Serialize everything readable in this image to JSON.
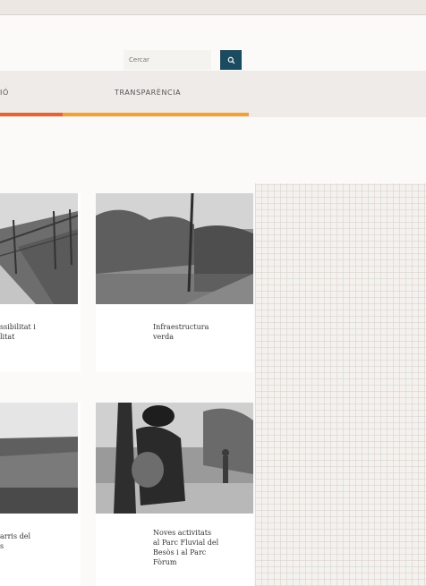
{
  "search": {
    "placeholder": "Cercar"
  },
  "nav": {
    "items": [
      {
        "label": "IÓ"
      },
      {
        "label": "TRANSPARÈNCIA"
      }
    ]
  },
  "cards": [
    {
      "title_lines": [
        "ssibilitat i",
        "litat"
      ]
    },
    {
      "title_lines": [
        "Infraestructura",
        "verda"
      ]
    },
    {
      "title_lines": [
        "arris del",
        "s"
      ]
    },
    {
      "title_lines": [
        "Noves activitats",
        "al Parc Fluvial del",
        "Besòs i al Parc",
        "Fòrum"
      ]
    }
  ]
}
